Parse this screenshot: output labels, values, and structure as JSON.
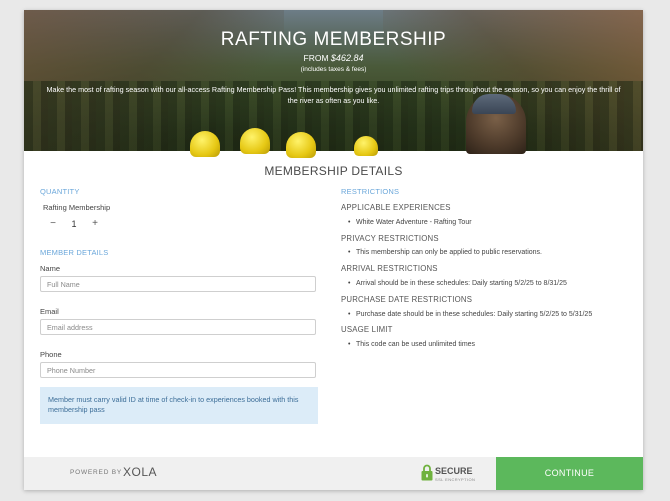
{
  "hero": {
    "title": "RAFTING MEMBERSHIP",
    "from_label": "FROM ",
    "price": "$462.84",
    "includes": "(includes taxes & fees)",
    "description": "Make the most of rafting season with our all-access Rafting Membership Pass! This membership gives you unlimited rafting trips throughout the season, so you can enjoy the thrill of the river as often as you like."
  },
  "section_title": "MEMBERSHIP DETAILS",
  "quantity": {
    "label": "QUANTITY",
    "item_name": "Rafting Membership",
    "minus": "−",
    "value": "1",
    "plus": "+"
  },
  "member_details": {
    "label": "MEMBER DETAILS",
    "name_label": "Name",
    "name_placeholder": "Full Name",
    "email_label": "Email",
    "email_placeholder": "Email address",
    "phone_label": "Phone",
    "phone_placeholder": "Phone Number",
    "notice": "Member must carry valid ID at time of check-in to experiences booked with this membership pass"
  },
  "restrictions": {
    "label": "RESTRICTIONS",
    "sections": [
      {
        "heading": "APPLICABLE EXPERIENCES",
        "item": "White Water Adventure - Rafting Tour"
      },
      {
        "heading": "PRIVACY RESTRICTIONS",
        "item": "This membership can only be applied to public reservations."
      },
      {
        "heading": "ARRIVAL RESTRICTIONS",
        "item": "Arrival should be in these schedules: Daily starting 5/2/25 to 8/31/25"
      },
      {
        "heading": "PURCHASE DATE RESTRICTIONS",
        "item": "Purchase date should be in these schedules: Daily starting 5/2/25 to 5/31/25"
      },
      {
        "heading": "USAGE LIMIT",
        "item": "This code can be used unlimited times"
      }
    ]
  },
  "footer": {
    "powered_by": "POWERED BY",
    "brand": "XOLA",
    "secure": "SECURE",
    "secure_sub": "SSL ENCRYPTION",
    "continue": "CONTINUE"
  },
  "colors": {
    "accent_blue": "#6ba7da",
    "continue_green": "#5cb85c",
    "notice_bg": "#dcecf8"
  },
  "icons": [
    "lock-icon"
  ]
}
